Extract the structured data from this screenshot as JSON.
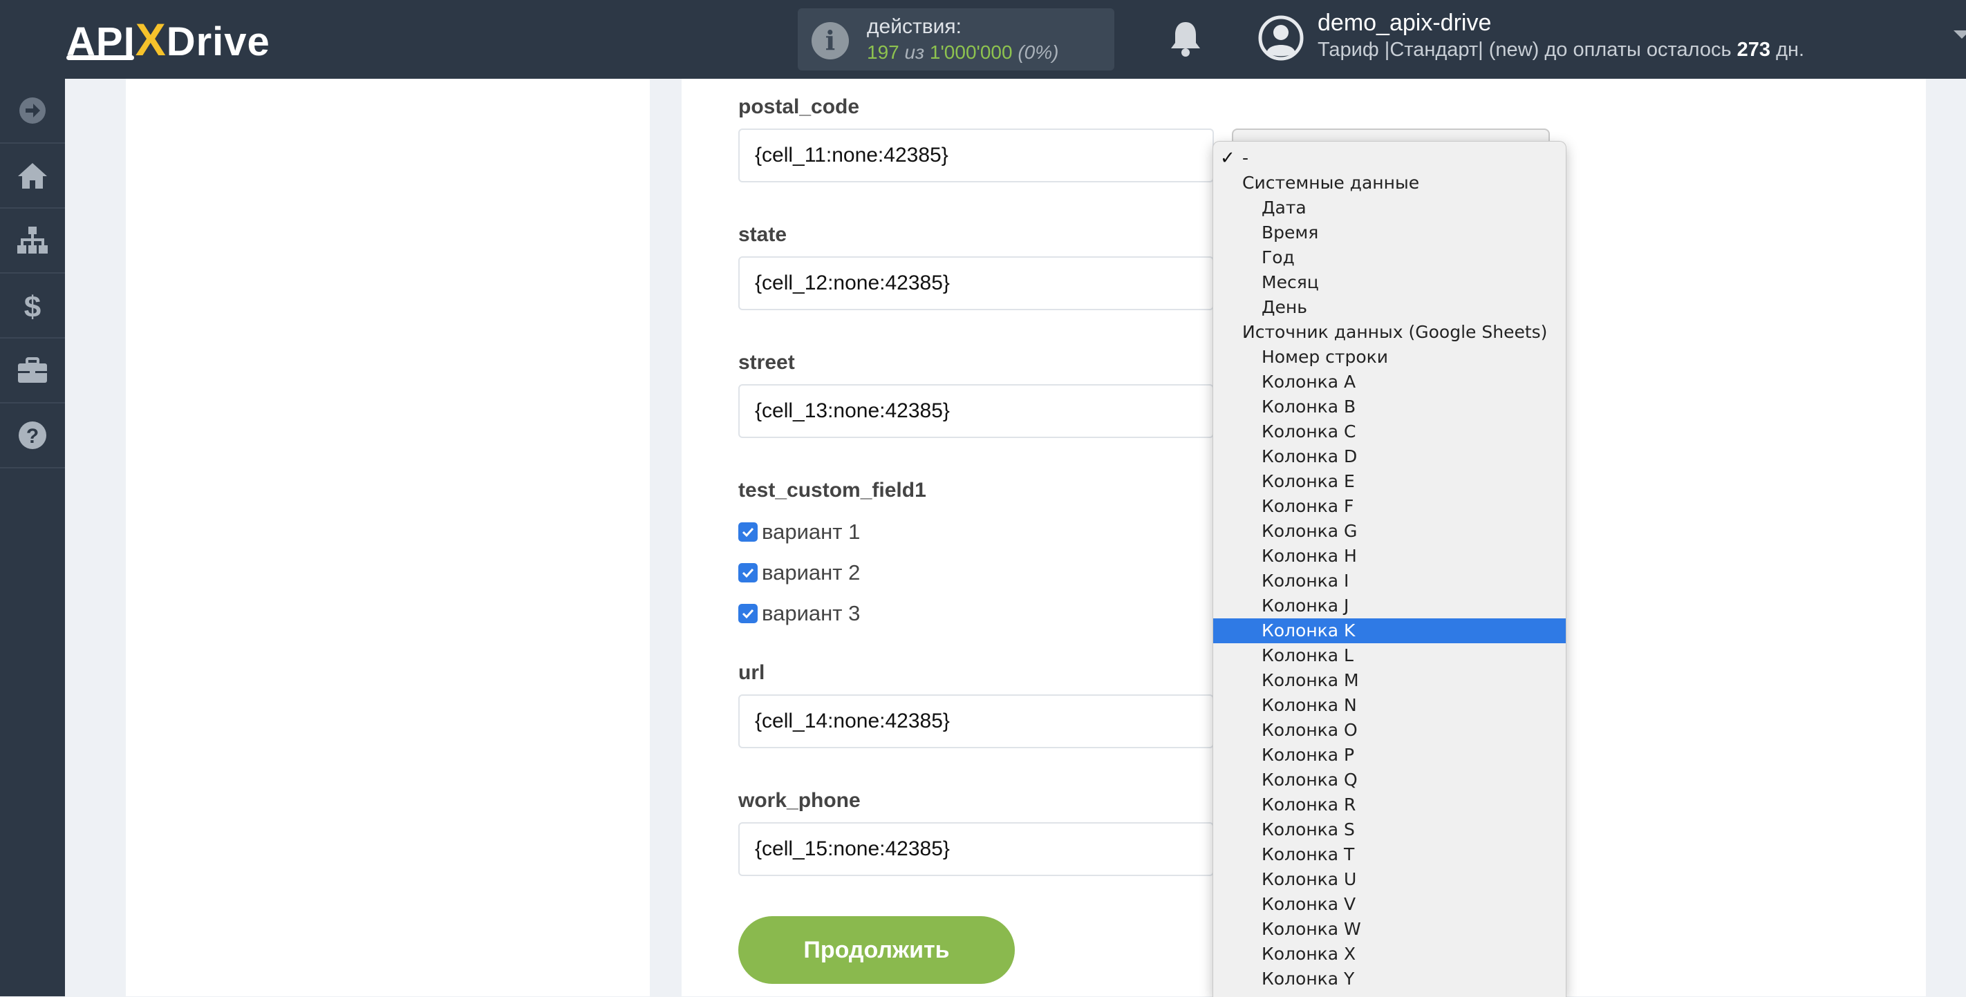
{
  "header": {
    "logo": {
      "prefix": "API",
      "x": "X",
      "suffix": "Drive"
    },
    "actions": {
      "label": "действия:",
      "used": "197",
      "of_word": "из",
      "total": "1'000'000",
      "percent": "(0%)"
    },
    "user": {
      "name": "demo_apix-drive",
      "tariff_text": "Тариф |Стандарт| (new) до оплаты осталось",
      "days": "273",
      "days_unit": "дн."
    }
  },
  "sidebar": {
    "items": [
      {
        "name": "arrow-right-icon"
      },
      {
        "name": "home-icon"
      },
      {
        "name": "sitemap-icon"
      },
      {
        "name": "dollar-icon"
      },
      {
        "name": "briefcase-icon"
      },
      {
        "name": "help-icon"
      }
    ]
  },
  "form": {
    "fields": [
      {
        "label": "postal_code",
        "value": "{cell_11:none:42385}"
      },
      {
        "label": "state",
        "value": "{cell_12:none:42385}"
      },
      {
        "label": "street",
        "value": "{cell_13:none:42385}"
      },
      {
        "label": "url",
        "value": "{cell_14:none:42385}"
      },
      {
        "label": "work_phone",
        "value": "{cell_15:none:42385}"
      }
    ],
    "custom_field": {
      "label": "test_custom_field1",
      "options": [
        {
          "label": "вариант 1",
          "checked": true
        },
        {
          "label": "вариант 2",
          "checked": true
        },
        {
          "label": "вариант 3",
          "checked": true
        }
      ]
    },
    "continue_label": "Продолжить"
  },
  "dropdown": {
    "checked_item": "-",
    "groups": [
      {
        "label": "Системные данные",
        "options": [
          "Дата",
          "Время",
          "Год",
          "Месяц",
          "День"
        ]
      },
      {
        "label": "Источник данных (Google Sheets)",
        "options": [
          "Номер строки",
          "Колонка A",
          "Колонка B",
          "Колонка C",
          "Колонка D",
          "Колонка E",
          "Колонка F",
          "Колонка G",
          "Колонка H",
          "Колонка I",
          "Колонка J",
          "Колонка K",
          "Колонка L",
          "Колонка M",
          "Колонка N",
          "Колонка O",
          "Колонка P",
          "Колонка Q",
          "Колонка R",
          "Колонка S",
          "Колонка T",
          "Колонка U",
          "Колонка V",
          "Колонка W",
          "Колонка X",
          "Колонка Y"
        ]
      }
    ],
    "highlighted": "Колонка K"
  },
  "colors": {
    "header_bg": "#2d3846",
    "accent_green": "#8ab94e",
    "accent_blue": "#2f7ae5"
  }
}
